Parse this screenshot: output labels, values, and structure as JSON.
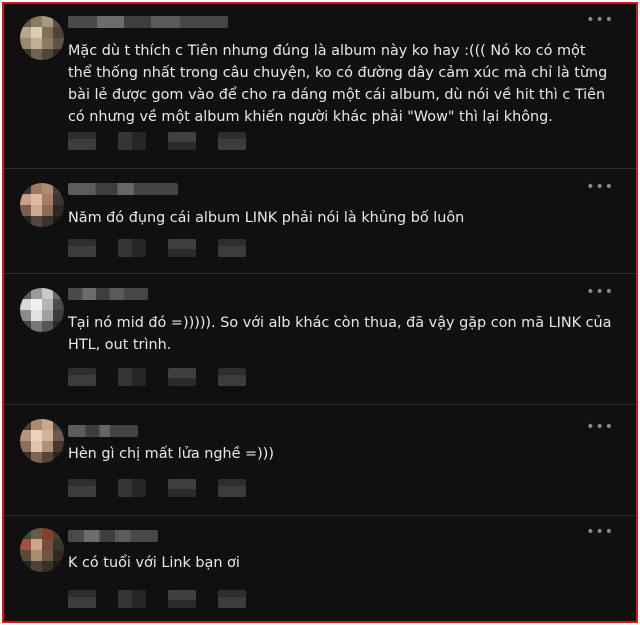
{
  "feed": {
    "more_glyph": "•••",
    "comments": [
      {
        "text": "Mặc dù t thích c Tiên nhưng đúng là album này ko hay :((( Nó ko có một thể thống nhất trong câu chuyện, ko có đường dây cảm xúc mà chỉ là từng bài lẻ được gom vào để cho ra dáng một cái album, dù nói về hit thì c Tiên có nhưng về một album khiến người khác phải \"Wow\" thì lại không."
      },
      {
        "text": "Năm đó đụng cái album LINK phải nói là khủng bố luôn"
      },
      {
        "text": "Tại nó mid đó =))))). So với alb khác còn thua, đã vậy gặp con mã LINK của HTL, out trình."
      },
      {
        "text": "Hèn gì chị mất lửa nghề =)))"
      },
      {
        "text": "K có tuổi với Link bạn ơi"
      }
    ]
  },
  "colors": {
    "border": "#d8151d",
    "background": "#101010",
    "text": "#e8e8e8",
    "divider": "#2f2f2f"
  }
}
